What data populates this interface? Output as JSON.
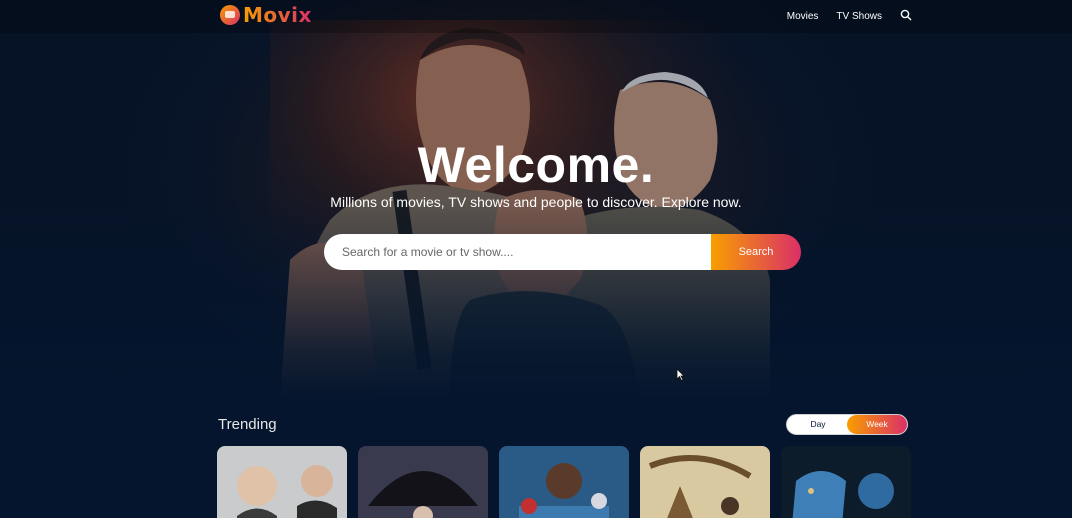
{
  "header": {
    "logo_text": "Movix",
    "nav": {
      "movies": "Movies",
      "tv_shows": "TV Shows"
    },
    "search_icon": "search-icon"
  },
  "hero": {
    "title": "Welcome.",
    "subtitle": "Millions of movies, TV shows and people to discover. Explore now.",
    "search": {
      "placeholder": "Search for a movie or tv show....",
      "value": "",
      "button_label": "Search"
    }
  },
  "trending": {
    "title": "Trending",
    "switch": {
      "options": [
        "Day",
        "Week"
      ],
      "active": "Week"
    },
    "cards": 5
  },
  "colors": {
    "background": "#04152d",
    "gradient_start": "#f89e00",
    "gradient_end": "#da2f68"
  }
}
